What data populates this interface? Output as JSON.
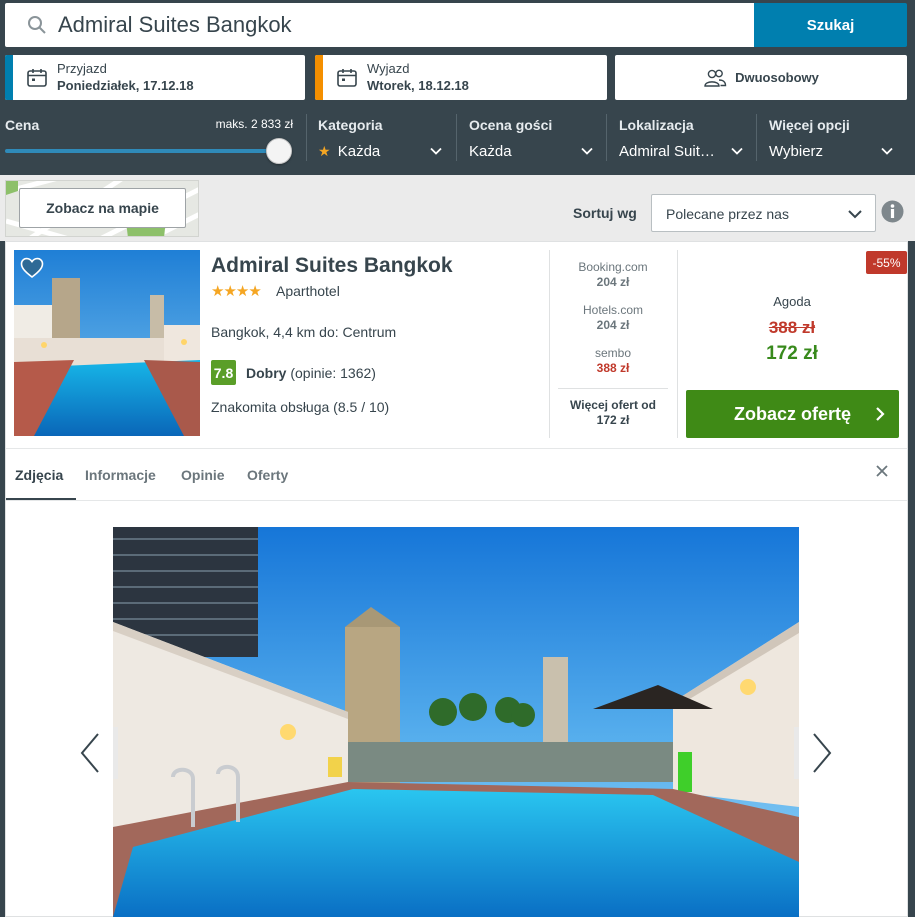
{
  "search": {
    "value": "Admiral Suites Bangkok",
    "button": "Szukaj"
  },
  "checkin": {
    "label": "Przyjazd",
    "value": "Poniedziałek, 17.12.18",
    "accent": "#007faf"
  },
  "checkout": {
    "label": "Wyjazd",
    "value": "Wtorek, 18.12.18",
    "accent": "#f48f00"
  },
  "room": {
    "label": "Dwuosobowy"
  },
  "filters": {
    "price": {
      "label": "Cena",
      "max_text": "maks. 2 833 zł",
      "slider_fraction": 1.0
    },
    "category": {
      "label": "Kategoria",
      "value": "Każda",
      "icon": "star-icon"
    },
    "rating": {
      "label": "Ocena gości",
      "value": "Każda"
    },
    "location": {
      "label": "Lokalizacja",
      "value": "Admiral Suit…"
    },
    "more": {
      "label": "Więcej opcji",
      "value": "Wybierz"
    }
  },
  "toolbar": {
    "map_button": "Zobacz na mapie",
    "sort_label": "Sortuj wg",
    "sort_value": "Polecane przez nas"
  },
  "hotel": {
    "name": "Admiral Suites Bangkok",
    "stars": "★★★★",
    "type": "Aparthotel",
    "location": "Bangkok, 4,4 km do: Centrum",
    "rating_score": "7.8",
    "rating_word": "Dobry",
    "rating_count": "(opinie: 1362)",
    "service": "Znakomita obsługa (8.5 / 10)",
    "alt_offers": [
      {
        "site": "Booking.com",
        "price": "204 zł",
        "highlight": false
      },
      {
        "site": "Hotels.com",
        "price": "204 zł",
        "highlight": false
      },
      {
        "site": "sembo",
        "price": "388 zł",
        "highlight": true
      }
    ],
    "more_offers_line1": "Więcej ofert od",
    "more_offers_line2": "172 zł",
    "discount_badge": "-55%",
    "provider": "Agoda",
    "old_price": "388 zł",
    "new_price": "172 zł",
    "cta": "Zobacz ofertę"
  },
  "tabs": [
    "Zdjęcia",
    "Informacje",
    "Opinie",
    "Oferty"
  ],
  "colors": {
    "header": "#37454d",
    "accent_blue": "#007faf",
    "cta_green": "#3f8a16",
    "rating_green": "#5a9e28",
    "discount_red": "#c0392b"
  }
}
